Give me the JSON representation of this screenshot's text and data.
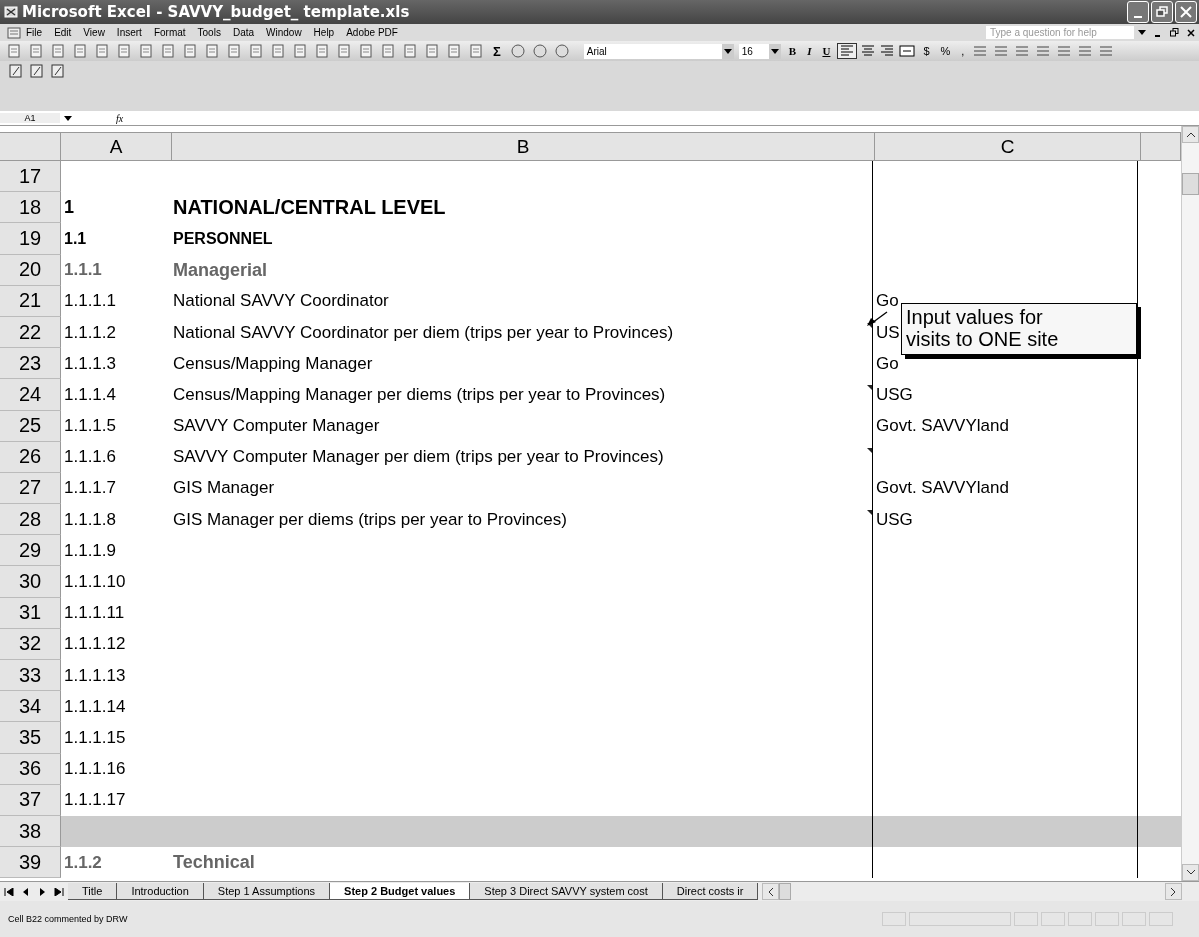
{
  "window": {
    "title": "Microsoft Excel - SAVVY_budget_ template.xls"
  },
  "menu": [
    "File",
    "Edit",
    "View",
    "Insert",
    "Format",
    "Tools",
    "Data",
    "Window",
    "Help",
    "Adobe PDF"
  ],
  "help_box": {
    "placeholder": "Type a question for help"
  },
  "toolbar": {
    "sigma": "Σ",
    "font": "Arial",
    "size": "16",
    "format_buttons": [
      {
        "label": "B",
        "kind": "bold",
        "selected": false
      },
      {
        "label": "I",
        "kind": "italic",
        "selected": false
      },
      {
        "label": "U",
        "kind": "underline",
        "selected": false
      }
    ],
    "align_left_selected": true,
    "number_buttons": [
      "$",
      "%",
      ","
    ]
  },
  "formula_bar": {
    "name_box": "A1",
    "fx": "fx"
  },
  "columns": [
    "A",
    "B",
    "C"
  ],
  "rows": [
    {
      "number": "17",
      "kind": "normal",
      "a": "",
      "b": "",
      "c": "",
      "commented": false
    },
    {
      "number": "18",
      "kind": "heading1",
      "a": "1",
      "b": "NATIONAL/CENTRAL LEVEL",
      "c": "",
      "commented": false
    },
    {
      "number": "19",
      "kind": "heading2",
      "a": "1.1",
      "b": "PERSONNEL",
      "c": "",
      "commented": false
    },
    {
      "number": "20",
      "kind": "heading3",
      "a": "1.1.1",
      "b": "Managerial",
      "c": "",
      "commented": false
    },
    {
      "number": "21",
      "kind": "normal",
      "a": "1.1.1.1",
      "b": "National SAVVY Coordinator",
      "c": "Go",
      "commented": false
    },
    {
      "number": "22",
      "kind": "normal",
      "a": "1.1.1.2",
      "b": "National SAVVY Coordinator per diem (trips per year to Provinces)",
      "c": "US",
      "commented": true
    },
    {
      "number": "23",
      "kind": "normal",
      "a": "1.1.1.3",
      "b": "Census/Mapping Manager",
      "c": "Go",
      "commented": false
    },
    {
      "number": "24",
      "kind": "normal",
      "a": "1.1.1.4",
      "b": "Census/Mapping Manager per diems (trips per year to Provinces)",
      "c": "USG",
      "commented": true
    },
    {
      "number": "25",
      "kind": "normal",
      "a": "1.1.1.5",
      "b": "SAVVY Computer Manager",
      "c": "Govt. SAVVYland",
      "commented": false
    },
    {
      "number": "26",
      "kind": "normal",
      "a": "1.1.1.6",
      "b": "SAVVY Computer Manager per diem (trips per year to Provinces)",
      "c": "",
      "commented": true
    },
    {
      "number": "27",
      "kind": "normal",
      "a": "1.1.1.7",
      "b": "GIS Manager",
      "c": "Govt. SAVVYland",
      "commented": false
    },
    {
      "number": "28",
      "kind": "normal",
      "a": "1.1.1.8",
      "b": "GIS Manager per diems (trips per year to Provinces)",
      "c": "USG",
      "commented": true
    },
    {
      "number": "29",
      "kind": "normal",
      "a": "1.1.1.9",
      "b": "",
      "c": "",
      "commented": false
    },
    {
      "number": "30",
      "kind": "normal",
      "a": "1.1.1.10",
      "b": "",
      "c": "",
      "commented": false
    },
    {
      "number": "31",
      "kind": "normal",
      "a": "1.1.1.11",
      "b": "",
      "c": "",
      "commented": false
    },
    {
      "number": "32",
      "kind": "normal",
      "a": "1.1.1.12",
      "b": "",
      "c": "",
      "commented": false
    },
    {
      "number": "33",
      "kind": "normal",
      "a": "1.1.1.13",
      "b": "",
      "c": "",
      "commented": false
    },
    {
      "number": "34",
      "kind": "normal",
      "a": "1.1.1.14",
      "b": "",
      "c": "",
      "commented": false
    },
    {
      "number": "35",
      "kind": "normal",
      "a": "1.1.1.15",
      "b": "",
      "c": "",
      "commented": false
    },
    {
      "number": "36",
      "kind": "normal",
      "a": "1.1.1.16",
      "b": "",
      "c": "",
      "commented": false
    },
    {
      "number": "37",
      "kind": "normal",
      "a": "1.1.1.17",
      "b": "",
      "c": "",
      "commented": false
    },
    {
      "number": "38",
      "kind": "band",
      "a": "",
      "b": "",
      "c": "",
      "commented": false
    },
    {
      "number": "39",
      "kind": "heading3",
      "a": "1.1.2",
      "b": "Technical",
      "c": "",
      "commented": false
    }
  ],
  "comment": {
    "text": "Input values for visits to ONE site"
  },
  "sheet_tabs": [
    {
      "label": "Title",
      "selected": false
    },
    {
      "label": "Introduction",
      "selected": false
    },
    {
      "label": "Step 1 Assumptions",
      "selected": false
    },
    {
      "label": "Step 2 Budget values",
      "selected": true
    },
    {
      "label": "Step 3 Direct SAVVY system cost",
      "selected": false
    },
    {
      "label": "Direct costs ir",
      "selected": false
    }
  ],
  "status_bar": {
    "text": "Cell B22 commented by DRW"
  }
}
